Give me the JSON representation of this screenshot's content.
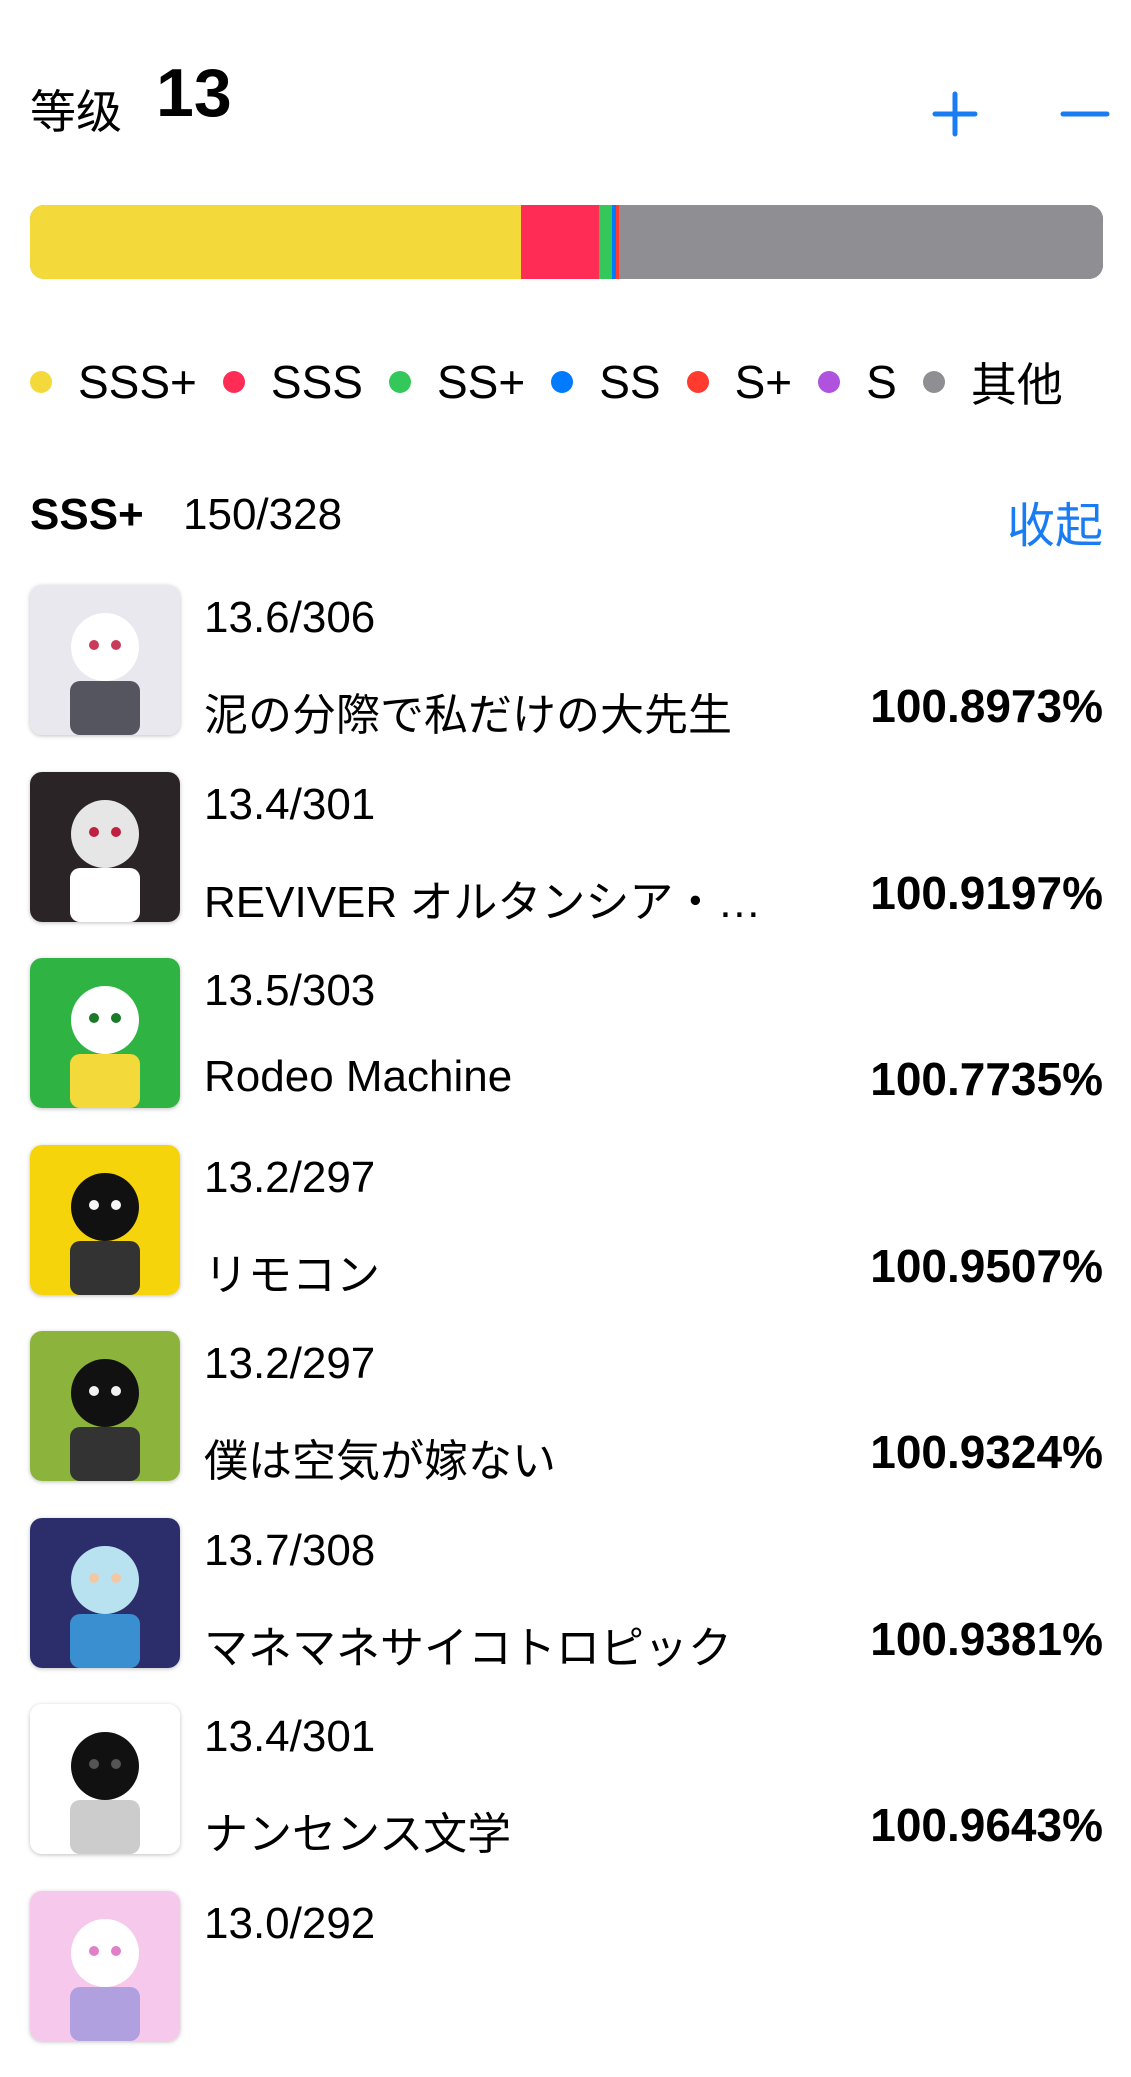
{
  "header": {
    "level_label": "等级",
    "level_value": "13",
    "plus_icon": "plus-icon",
    "minus_icon": "minus-icon"
  },
  "progress": {
    "segments": [
      {
        "name": "SSS+",
        "count": 150,
        "color": "#f4d93a"
      },
      {
        "name": "SSS",
        "count": 24,
        "color": "#ff2d55"
      },
      {
        "name": "SS+",
        "count": 4,
        "color": "#34c759"
      },
      {
        "name": "SS",
        "count": 1,
        "color": "#007aff"
      },
      {
        "name": "S+",
        "count": 1,
        "color": "#ff3b30"
      },
      {
        "name": "S",
        "count": 0,
        "color": "#af52de"
      },
      {
        "name": "其他",
        "count": 148,
        "color": "#8e8e93"
      }
    ],
    "total": 328
  },
  "legend": [
    {
      "label": "SSS+",
      "color": "#f4d93a"
    },
    {
      "label": "SSS",
      "color": "#ff2d55"
    },
    {
      "label": "SS+",
      "color": "#34c759"
    },
    {
      "label": "SS",
      "color": "#007aff"
    },
    {
      "label": "S+",
      "color": "#ff3b30"
    },
    {
      "label": "S",
      "color": "#af52de"
    },
    {
      "label": "其他",
      "color": "#8e8e93"
    }
  ],
  "section": {
    "title": "SSS+",
    "count": "150/328",
    "collapse_label": "收起"
  },
  "songs": [
    {
      "const": "13.6/306",
      "title": "泥の分際で私だけの大先生",
      "score": "100.8973%",
      "cover_icon": "album-cover-icon"
    },
    {
      "const": "13.4/301",
      "title": "REVIVER オルタンシア・サーガ",
      "score": "100.9197%",
      "cover_icon": "album-cover-icon"
    },
    {
      "const": "13.5/303",
      "title": "Rodeo Machine",
      "score": "100.7735%",
      "cover_icon": "album-cover-icon"
    },
    {
      "const": "13.2/297",
      "title": "リモコン",
      "score": "100.9507%",
      "cover_icon": "album-cover-icon"
    },
    {
      "const": "13.2/297",
      "title": "僕は空気が嫁ない",
      "score": "100.9324%",
      "cover_icon": "album-cover-icon"
    },
    {
      "const": "13.7/308",
      "title": "マネマネサイコトロピック",
      "score": "100.9381%",
      "cover_icon": "album-cover-icon"
    },
    {
      "const": "13.4/301",
      "title": "ナンセンス文学",
      "score": "100.9643%",
      "cover_icon": "album-cover-icon"
    },
    {
      "const": "13.0/292",
      "title": "",
      "score": "",
      "cover_icon": "album-cover-icon"
    }
  ]
}
